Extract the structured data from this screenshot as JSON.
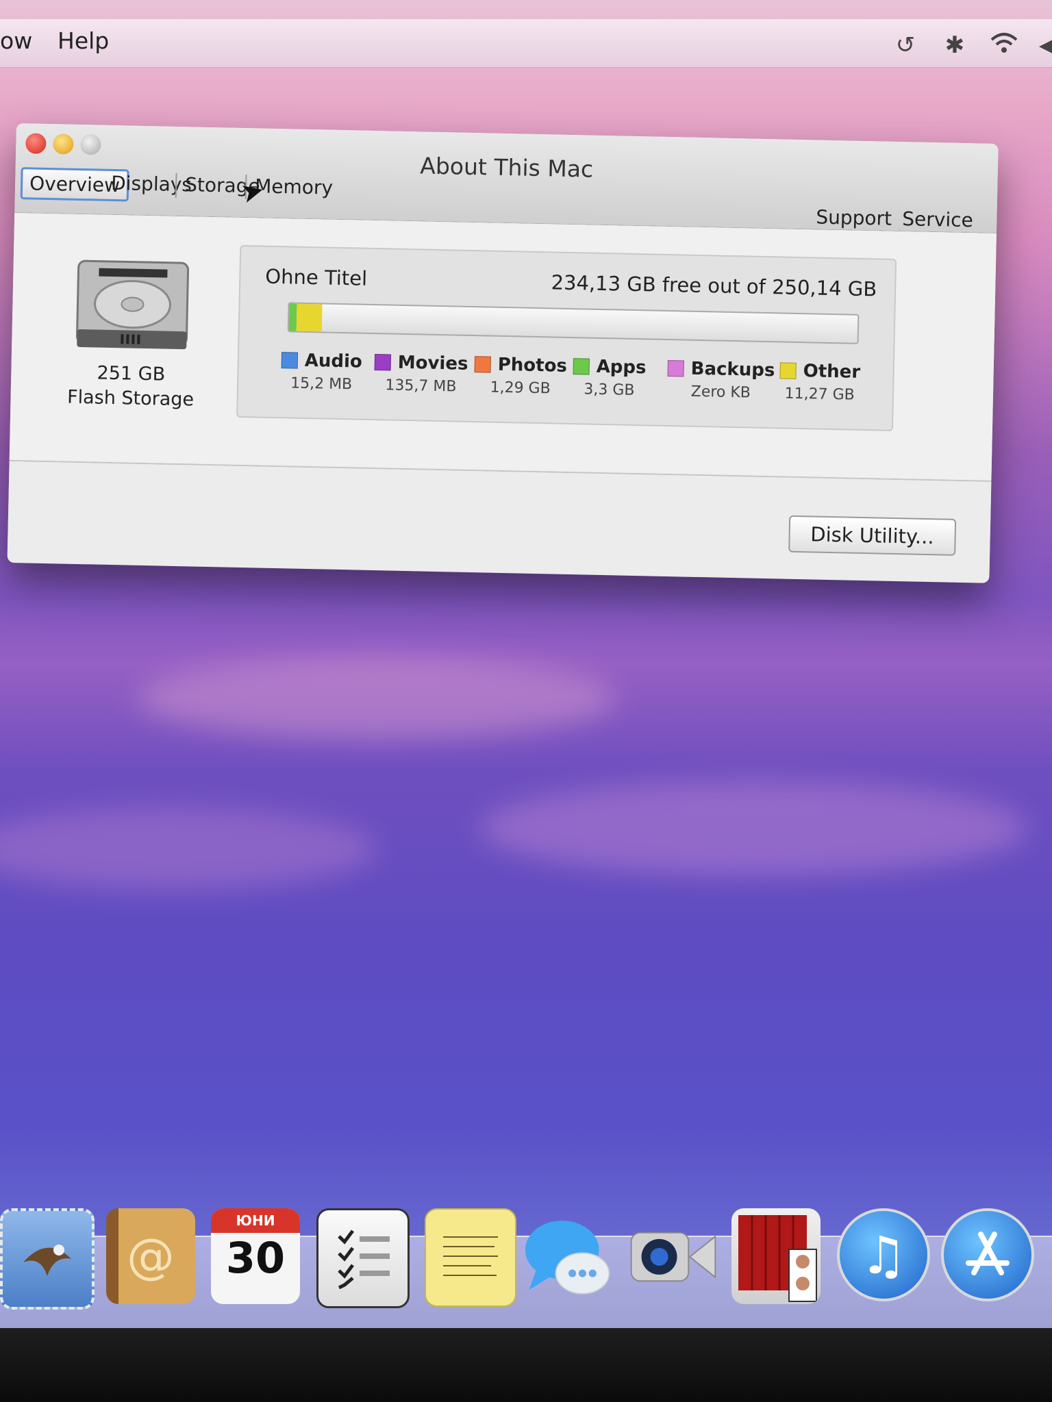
{
  "menubar": {
    "items": [
      "ow",
      "Help"
    ],
    "icons": [
      "time-machine-icon",
      "bluetooth-icon",
      "wifi-icon",
      "volume-icon"
    ]
  },
  "window": {
    "title": "About This Mac",
    "tabs": [
      {
        "label": "Overview",
        "active": true
      },
      {
        "label": "Displays",
        "active": false
      },
      {
        "label": "Storage",
        "active": false
      },
      {
        "label": "Memory",
        "active": false
      }
    ],
    "links": {
      "support": "Support",
      "service": "Service"
    }
  },
  "disk": {
    "capacity": "251 GB",
    "type": "Flash Storage",
    "volume_name": "Ohne Titel",
    "free_text": "234,13 GB free out of 250,14 GB"
  },
  "legend": [
    {
      "name": "Audio",
      "value": "15,2 MB",
      "color": "#4a8be0"
    },
    {
      "name": "Movies",
      "value": "135,7 MB",
      "color": "#9a3fc4"
    },
    {
      "name": "Photos",
      "value": "1,29 GB",
      "color": "#f07840"
    },
    {
      "name": "Apps",
      "value": "3,3 GB",
      "color": "#6cc94a"
    },
    {
      "name": "Backups",
      "value": "Zero KB",
      "color": "#d77ad8"
    },
    {
      "name": "Other",
      "value": "11,27 GB",
      "color": "#e8d630"
    }
  ],
  "usage_fraction": {
    "apps": 0.013,
    "other": 0.045,
    "free": 0.936
  },
  "buttons": {
    "disk_utility": "Disk Utility..."
  },
  "dock": {
    "calendar_month": "ЮНИ",
    "calendar_day": "30"
  }
}
